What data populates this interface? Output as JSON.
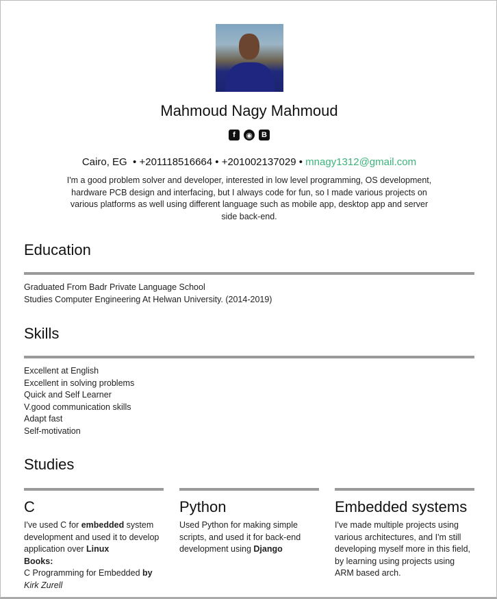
{
  "profile": {
    "name": "Mahmoud Nagy Mahmoud",
    "photo_alt": "profile photo",
    "social": [
      {
        "icon": "facebook-icon",
        "glyph": "f"
      },
      {
        "icon": "github-icon",
        "glyph": "◉"
      },
      {
        "icon": "blogger-icon",
        "glyph": "B"
      }
    ],
    "location": "Cairo, EG",
    "phone1": "+201118516664",
    "phone2": "+201002137029",
    "email": "mnagy1312@gmail.com",
    "sep": " • ",
    "bio": "I'm a good problem solver and developer, interested in low level programming, OS development, hardware PCB design and interfacing, but I always code for fun, so I made various projects on various platforms as well using different language such as mobile app, desktop app and server side back-end.",
    "accent": "#3cb37c"
  },
  "education": {
    "title": "Education",
    "items": [
      "Graduated From Badr Private Language School",
      "Studies Computer Engineering At Helwan University. (2014-2019)"
    ]
  },
  "skills": {
    "title": "Skills",
    "items": [
      "Excellent at English",
      "Excellent in solving problems",
      "Quick and Self Learner",
      "V.good communication skills",
      "Adapt fast",
      "Self-motivation"
    ]
  },
  "studies": {
    "title": "Studies",
    "columns": [
      {
        "title": "C",
        "t1": "I've used C for ",
        "b1": "embedded",
        "t2": " system development and used it to develop application over ",
        "b2": "Linux",
        "books_label": "Books:",
        "t3": "C Programming for Embedded ",
        "b3": "by",
        "i1": " Kirk Zurell"
      },
      {
        "title": "Python",
        "t1": "Used Python for making simple scripts, and used it for back-end development using ",
        "b1": "Django"
      },
      {
        "title": "Embedded systems",
        "t1": "I've made multiple projects using various architectures, and I'm still developing myself more in this field, by learning using projects using ARM based arch."
      }
    ]
  }
}
